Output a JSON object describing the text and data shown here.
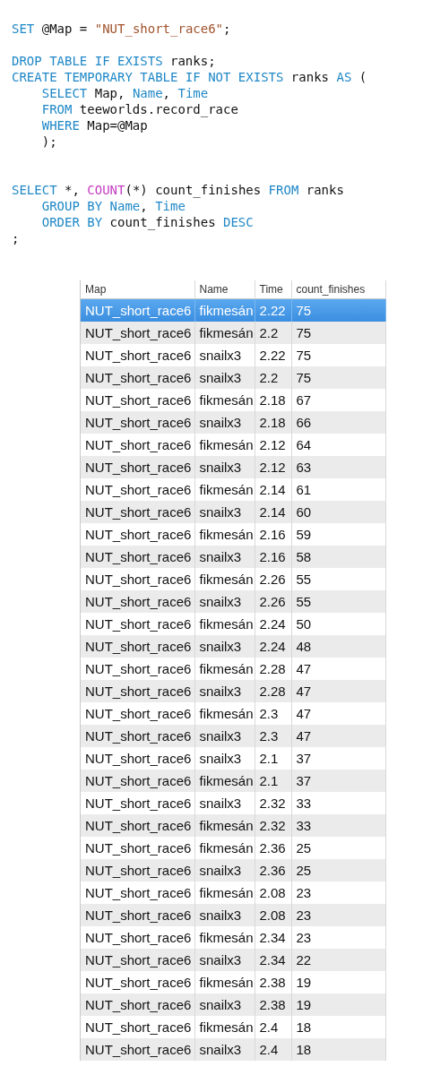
{
  "editor": {
    "lines": [
      {
        "kind": "code",
        "tokens": [
          {
            "text": "SET",
            "kind": "keyword"
          },
          {
            "text": " @Map = ",
            "kind": "plain"
          },
          {
            "text": "\"NUT_short_race6\"",
            "kind": "string"
          },
          {
            "text": ";",
            "kind": "plain"
          }
        ]
      },
      {
        "kind": "blank"
      },
      {
        "kind": "code",
        "tokens": [
          {
            "text": "DROP TABLE IF EXISTS",
            "kind": "keyword"
          },
          {
            "text": " ranks;",
            "kind": "plain"
          }
        ]
      },
      {
        "kind": "code",
        "tokens": [
          {
            "text": "CREATE TEMPORARY TABLE IF NOT EXISTS",
            "kind": "keyword"
          },
          {
            "text": " ranks ",
            "kind": "plain"
          },
          {
            "text": "AS",
            "kind": "keyword"
          },
          {
            "text": " (",
            "kind": "plain"
          }
        ]
      },
      {
        "kind": "code",
        "tokens": [
          {
            "text": "    SELECT",
            "kind": "keyword"
          },
          {
            "text": " Map, ",
            "kind": "plain"
          },
          {
            "text": "Name",
            "kind": "keyword"
          },
          {
            "text": ", ",
            "kind": "plain"
          },
          {
            "text": "Time",
            "kind": "keyword"
          }
        ]
      },
      {
        "kind": "code",
        "tokens": [
          {
            "text": "    FROM",
            "kind": "keyword"
          },
          {
            "text": " teeworlds.record_race",
            "kind": "plain"
          }
        ]
      },
      {
        "kind": "code",
        "tokens": [
          {
            "text": "    WHERE",
            "kind": "keyword"
          },
          {
            "text": " Map=@Map",
            "kind": "plain"
          }
        ]
      },
      {
        "kind": "code",
        "tokens": [
          {
            "text": "    );",
            "kind": "plain"
          }
        ]
      },
      {
        "kind": "blank"
      },
      {
        "kind": "blank"
      },
      {
        "kind": "code",
        "tokens": [
          {
            "text": "SELECT",
            "kind": "keyword"
          },
          {
            "text": " *, ",
            "kind": "plain"
          },
          {
            "text": "COUNT",
            "kind": "function"
          },
          {
            "text": "(*) count_finishes ",
            "kind": "plain"
          },
          {
            "text": "FROM",
            "kind": "keyword"
          },
          {
            "text": " ranks",
            "kind": "plain"
          }
        ]
      },
      {
        "kind": "code",
        "tokens": [
          {
            "text": "    GROUP BY Name",
            "kind": "keyword"
          },
          {
            "text": ", ",
            "kind": "plain"
          },
          {
            "text": "Time",
            "kind": "keyword"
          }
        ]
      },
      {
        "kind": "code",
        "tokens": [
          {
            "text": "    ORDER BY",
            "kind": "keyword"
          },
          {
            "text": " count_finishes ",
            "kind": "plain"
          },
          {
            "text": "DESC",
            "kind": "keyword"
          }
        ]
      },
      {
        "kind": "code",
        "tokens": [
          {
            "text": ";",
            "kind": "plain"
          }
        ]
      }
    ]
  },
  "table": {
    "columns": [
      "Map",
      "Name",
      "Time",
      "count_finishes"
    ],
    "rows": [
      {
        "cells": [
          "NUT_short_race6",
          "fikmesán",
          "2.22",
          "75"
        ],
        "selected": true
      },
      {
        "cells": [
          "NUT_short_race6",
          "fikmesán",
          "2.2",
          "75"
        ],
        "selected": false
      },
      {
        "cells": [
          "NUT_short_race6",
          "snailx3",
          "2.22",
          "75"
        ],
        "selected": false
      },
      {
        "cells": [
          "NUT_short_race6",
          "snailx3",
          "2.2",
          "75"
        ],
        "selected": false
      },
      {
        "cells": [
          "NUT_short_race6",
          "fikmesán",
          "2.18",
          "67"
        ],
        "selected": false
      },
      {
        "cells": [
          "NUT_short_race6",
          "snailx3",
          "2.18",
          "66"
        ],
        "selected": false
      },
      {
        "cells": [
          "NUT_short_race6",
          "fikmesán",
          "2.12",
          "64"
        ],
        "selected": false
      },
      {
        "cells": [
          "NUT_short_race6",
          "snailx3",
          "2.12",
          "63"
        ],
        "selected": false
      },
      {
        "cells": [
          "NUT_short_race6",
          "fikmesán",
          "2.14",
          "61"
        ],
        "selected": false
      },
      {
        "cells": [
          "NUT_short_race6",
          "snailx3",
          "2.14",
          "60"
        ],
        "selected": false
      },
      {
        "cells": [
          "NUT_short_race6",
          "fikmesán",
          "2.16",
          "59"
        ],
        "selected": false
      },
      {
        "cells": [
          "NUT_short_race6",
          "snailx3",
          "2.16",
          "58"
        ],
        "selected": false
      },
      {
        "cells": [
          "NUT_short_race6",
          "fikmesán",
          "2.26",
          "55"
        ],
        "selected": false
      },
      {
        "cells": [
          "NUT_short_race6",
          "snailx3",
          "2.26",
          "55"
        ],
        "selected": false
      },
      {
        "cells": [
          "NUT_short_race6",
          "fikmesán",
          "2.24",
          "50"
        ],
        "selected": false
      },
      {
        "cells": [
          "NUT_short_race6",
          "snailx3",
          "2.24",
          "48"
        ],
        "selected": false
      },
      {
        "cells": [
          "NUT_short_race6",
          "fikmesán",
          "2.28",
          "47"
        ],
        "selected": false
      },
      {
        "cells": [
          "NUT_short_race6",
          "snailx3",
          "2.28",
          "47"
        ],
        "selected": false
      },
      {
        "cells": [
          "NUT_short_race6",
          "fikmesán",
          "2.3",
          "47"
        ],
        "selected": false
      },
      {
        "cells": [
          "NUT_short_race6",
          "snailx3",
          "2.3",
          "47"
        ],
        "selected": false
      },
      {
        "cells": [
          "NUT_short_race6",
          "snailx3",
          "2.1",
          "37"
        ],
        "selected": false
      },
      {
        "cells": [
          "NUT_short_race6",
          "fikmesán",
          "2.1",
          "37"
        ],
        "selected": false
      },
      {
        "cells": [
          "NUT_short_race6",
          "snailx3",
          "2.32",
          "33"
        ],
        "selected": false
      },
      {
        "cells": [
          "NUT_short_race6",
          "fikmesán",
          "2.32",
          "33"
        ],
        "selected": false
      },
      {
        "cells": [
          "NUT_short_race6",
          "fikmesán",
          "2.36",
          "25"
        ],
        "selected": false
      },
      {
        "cells": [
          "NUT_short_race6",
          "snailx3",
          "2.36",
          "25"
        ],
        "selected": false
      },
      {
        "cells": [
          "NUT_short_race6",
          "fikmesán",
          "2.08",
          "23"
        ],
        "selected": false
      },
      {
        "cells": [
          "NUT_short_race6",
          "snailx3",
          "2.08",
          "23"
        ],
        "selected": false
      },
      {
        "cells": [
          "NUT_short_race6",
          "fikmesán",
          "2.34",
          "23"
        ],
        "selected": false
      },
      {
        "cells": [
          "NUT_short_race6",
          "snailx3",
          "2.34",
          "22"
        ],
        "selected": false
      },
      {
        "cells": [
          "NUT_short_race6",
          "fikmesán",
          "2.38",
          "19"
        ],
        "selected": false
      },
      {
        "cells": [
          "NUT_short_race6",
          "snailx3",
          "2.38",
          "19"
        ],
        "selected": false
      },
      {
        "cells": [
          "NUT_short_race6",
          "fikmesán",
          "2.4",
          "18"
        ],
        "selected": false
      },
      {
        "cells": [
          "NUT_short_race6",
          "snailx3",
          "2.4",
          "18"
        ],
        "selected": false
      }
    ]
  }
}
